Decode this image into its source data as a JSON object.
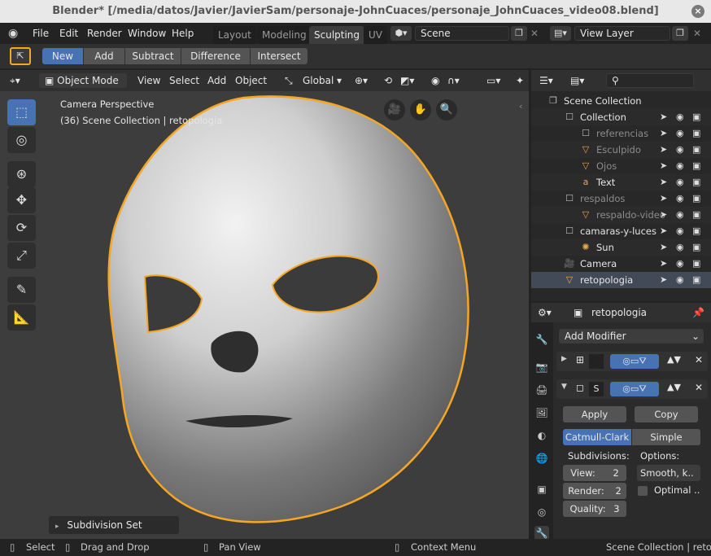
{
  "window": {
    "title": "Blender* [/media/datos/Javier/JavierSam/personaje-JohnCuaces/personaje_JohnCuaces_video08.blend]",
    "close_glyph": "×"
  },
  "menu": {
    "items": [
      "File",
      "Edit",
      "Render",
      "Window",
      "Help"
    ],
    "workspaces": [
      "Layout",
      "Modeling",
      "Sculpting",
      "UV"
    ],
    "active_workspace": "Sculpting",
    "scene": "Scene",
    "view_layer": "View Layer"
  },
  "tool_settings": {
    "modes": [
      "New",
      "Add",
      "Subtract",
      "Difference",
      "Intersect"
    ],
    "active_mode": "New"
  },
  "viewport_header": {
    "mode": "Object Mode",
    "menus": [
      "View",
      "Select",
      "Add",
      "Object"
    ],
    "orientation": "Global"
  },
  "viewport": {
    "overlay_title": "Camera Perspective",
    "overlay_subtitle": "(36) Scene Collection | retopologia",
    "last_operator": "Subdivision Set",
    "accent": "#f5a623"
  },
  "outliner": {
    "rows": [
      {
        "label": "Scene Collection",
        "indent": 0,
        "icon": "scene-collection-icon"
      },
      {
        "label": "Collection",
        "indent": 1,
        "icon": "collection-icon"
      },
      {
        "label": "referencias",
        "indent": 2,
        "icon": "collection-icon",
        "dim": true
      },
      {
        "label": "Esculpido",
        "indent": 2,
        "icon": "mesh-icon",
        "dim": true
      },
      {
        "label": "Ojos",
        "indent": 2,
        "icon": "mesh-icon",
        "dim": true
      },
      {
        "label": "Text",
        "indent": 2,
        "icon": "text-icon"
      },
      {
        "label": "respaldos",
        "indent": 1,
        "icon": "collection-icon",
        "dim": true
      },
      {
        "label": "respaldo-video",
        "indent": 2,
        "icon": "mesh-icon",
        "dim": true
      },
      {
        "label": "camaras-y-luces",
        "indent": 1,
        "icon": "collection-icon"
      },
      {
        "label": "Sun",
        "indent": 2,
        "icon": "light-icon"
      },
      {
        "label": "Camera",
        "indent": 1,
        "icon": "camera-icon"
      },
      {
        "label": "retopologia",
        "indent": 1,
        "icon": "mesh-icon",
        "selected": true
      }
    ]
  },
  "properties": {
    "object_name": "retopologia",
    "add_modifier": "Add Modifier",
    "modifier2_name": "S",
    "apply": "Apply",
    "copy": "Copy",
    "catmull": "Catmull-Clark",
    "simple": "Simple",
    "subdivisions_label": "Subdivisions:",
    "options_label": "Options:",
    "view": "View:",
    "view_value": "2",
    "render": "Render:",
    "render_value": "2",
    "quality": "Quality:",
    "quality_value": "3",
    "smooth": "Smooth, k..",
    "optimal": "Optimal .."
  },
  "statusbar": {
    "select": "Select",
    "drag": "Drag and Drop",
    "pan": "Pan View",
    "context": "Context Menu",
    "right": "Scene Collection | retopolo"
  }
}
